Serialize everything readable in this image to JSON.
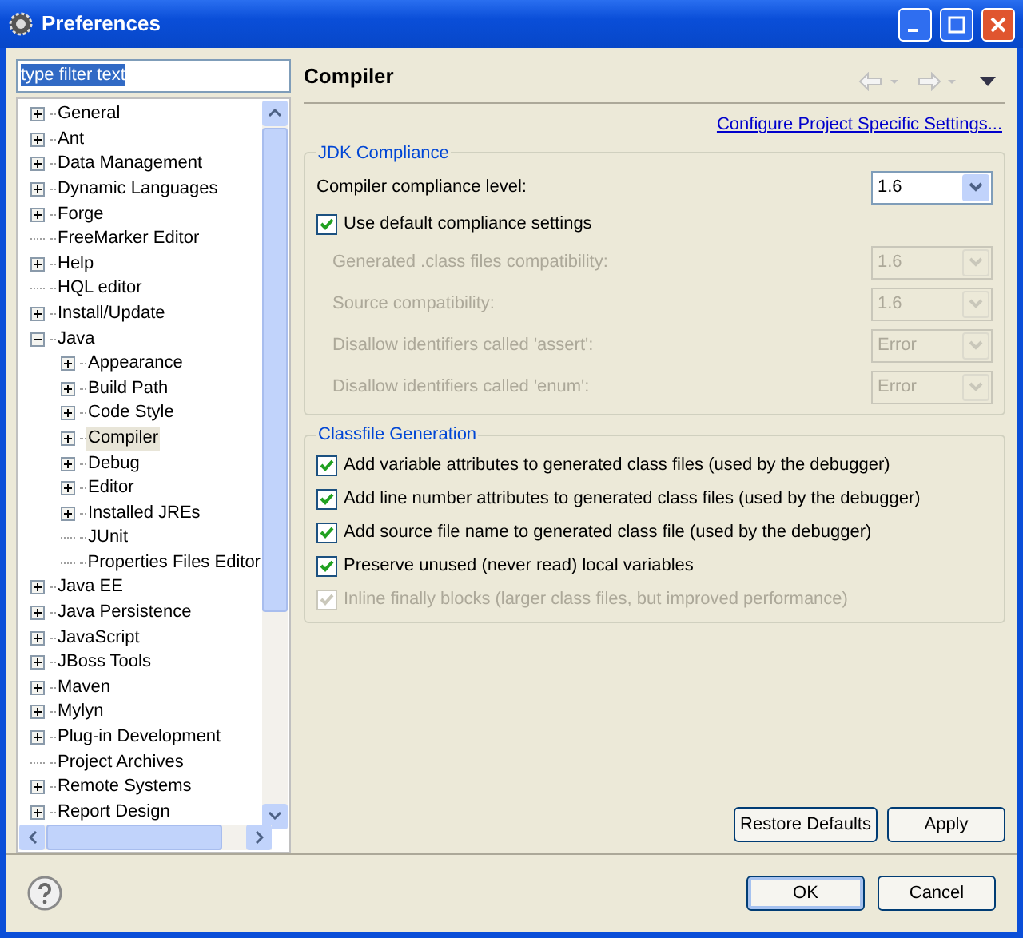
{
  "window": {
    "title": "Preferences"
  },
  "filter": {
    "value": "type filter text"
  },
  "tree": [
    {
      "label": "General",
      "kind": "branch",
      "expanded": false,
      "selected": false
    },
    {
      "label": "Ant",
      "kind": "branch",
      "expanded": false,
      "selected": false
    },
    {
      "label": "Data Management",
      "kind": "branch",
      "expanded": false,
      "selected": false
    },
    {
      "label": "Dynamic Languages",
      "kind": "branch",
      "expanded": false,
      "selected": false
    },
    {
      "label": "Forge",
      "kind": "branch",
      "expanded": false,
      "selected": false
    },
    {
      "label": "FreeMarker Editor",
      "kind": "leaf",
      "selected": false
    },
    {
      "label": "Help",
      "kind": "branch",
      "expanded": false,
      "selected": false
    },
    {
      "label": "HQL editor",
      "kind": "leaf",
      "selected": false
    },
    {
      "label": "Install/Update",
      "kind": "branch",
      "expanded": false,
      "selected": false
    },
    {
      "label": "Java",
      "kind": "branch",
      "expanded": true,
      "selected": false,
      "children": [
        {
          "label": "Appearance",
          "kind": "branch",
          "expanded": false,
          "selected": false
        },
        {
          "label": "Build Path",
          "kind": "branch",
          "expanded": false,
          "selected": false
        },
        {
          "label": "Code Style",
          "kind": "branch",
          "expanded": false,
          "selected": false
        },
        {
          "label": "Compiler",
          "kind": "branch",
          "expanded": false,
          "selected": true
        },
        {
          "label": "Debug",
          "kind": "branch",
          "expanded": false,
          "selected": false
        },
        {
          "label": "Editor",
          "kind": "branch",
          "expanded": false,
          "selected": false
        },
        {
          "label": "Installed JREs",
          "kind": "branch",
          "expanded": false,
          "selected": false
        },
        {
          "label": "JUnit",
          "kind": "leaf",
          "selected": false
        },
        {
          "label": "Properties Files Editor",
          "kind": "leaf",
          "selected": false
        }
      ]
    },
    {
      "label": "Java EE",
      "kind": "branch",
      "expanded": false,
      "selected": false
    },
    {
      "label": "Java Persistence",
      "kind": "branch",
      "expanded": false,
      "selected": false
    },
    {
      "label": "JavaScript",
      "kind": "branch",
      "expanded": false,
      "selected": false
    },
    {
      "label": "JBoss Tools",
      "kind": "branch",
      "expanded": false,
      "selected": false
    },
    {
      "label": "Maven",
      "kind": "branch",
      "expanded": false,
      "selected": false
    },
    {
      "label": "Mylyn",
      "kind": "branch",
      "expanded": false,
      "selected": false
    },
    {
      "label": "Plug-in Development",
      "kind": "branch",
      "expanded": false,
      "selected": false
    },
    {
      "label": "Project Archives",
      "kind": "leaf",
      "selected": false
    },
    {
      "label": "Remote Systems",
      "kind": "branch",
      "expanded": false,
      "selected": false
    },
    {
      "label": "Report Design",
      "kind": "branch",
      "expanded": false,
      "selected": false
    }
  ],
  "page": {
    "title": "Compiler",
    "link": "Configure Project Specific Settings...",
    "jdk_group": {
      "title": "JDK Compliance",
      "compliance": {
        "label": "Compiler compliance level:",
        "value": "1.6",
        "disabled": false
      },
      "use_default": {
        "label": "Use default compliance settings",
        "checked": true,
        "disabled": false
      },
      "fields": [
        {
          "label": "Generated .class files compatibility:",
          "value": "1.6",
          "disabled": true
        },
        {
          "label": "Source compatibility:",
          "value": "1.6",
          "disabled": true
        },
        {
          "label": "Disallow identifiers called 'assert':",
          "value": "Error",
          "disabled": true
        },
        {
          "label": "Disallow identifiers called 'enum':",
          "value": "Error",
          "disabled": true
        }
      ]
    },
    "classfile_group": {
      "title": "Classfile Generation",
      "options": [
        {
          "label": "Add variable attributes to generated class files (used by the debugger)",
          "checked": true,
          "disabled": false
        },
        {
          "label": "Add line number attributes to generated class files (used by the debugger)",
          "checked": true,
          "disabled": false
        },
        {
          "label": "Add source file name to generated class file (used by the debugger)",
          "checked": true,
          "disabled": false
        },
        {
          "label": "Preserve unused (never read) local variables",
          "checked": true,
          "disabled": false
        },
        {
          "label": "Inline finally blocks (larger class files, but improved performance)",
          "checked": true,
          "disabled": true
        }
      ]
    },
    "buttons": [
      "Restore Defaults",
      "Apply"
    ]
  },
  "dialog_buttons": [
    {
      "label": "OK",
      "default": true
    },
    {
      "label": "Cancel",
      "default": false
    }
  ]
}
